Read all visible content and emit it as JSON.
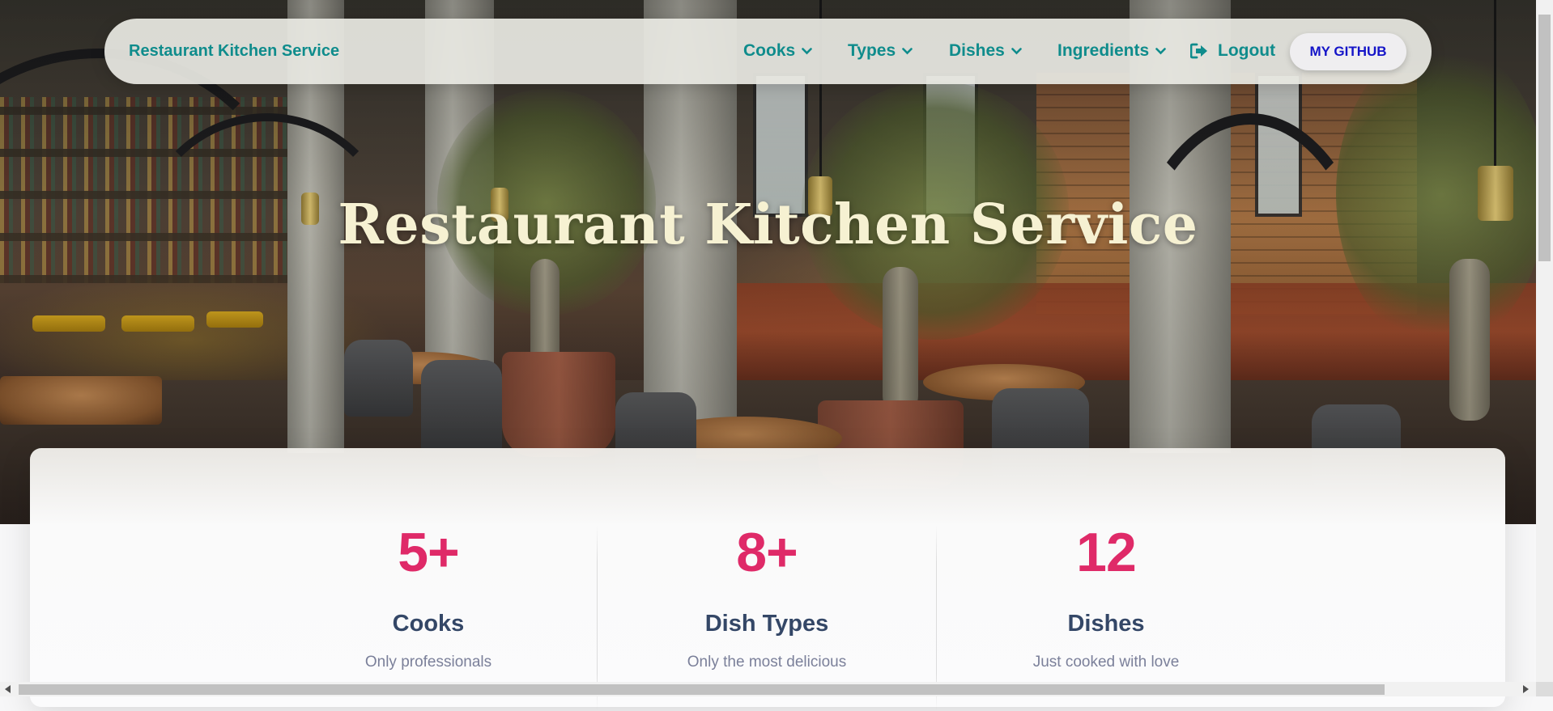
{
  "navbar": {
    "brand": "Restaurant Kitchen Service",
    "items": [
      {
        "label": "Cooks"
      },
      {
        "label": "Types"
      },
      {
        "label": "Dishes"
      },
      {
        "label": "Ingredients"
      }
    ],
    "logout_label": "Logout",
    "github_label": "MY GITHUB"
  },
  "hero": {
    "title": "Restaurant Kitchen Service"
  },
  "stats": [
    {
      "number": "5+",
      "title": "Cooks",
      "description": "Only professionals"
    },
    {
      "number": "8+",
      "title": "Dish Types",
      "description": "Only the most delicious"
    },
    {
      "number": "12",
      "title": "Dishes",
      "description": "Just cooked with love"
    }
  ],
  "colors": {
    "brand_teal": "#0f8c8c",
    "stat_accent": "#df2a68",
    "stat_title": "#344767",
    "stat_desc": "#7b809a",
    "github_text": "#1414c8",
    "hero_title": "#f6f1d2"
  },
  "icons": {
    "dropdown": "chevron-down-icon",
    "logout": "sign-out-icon"
  }
}
